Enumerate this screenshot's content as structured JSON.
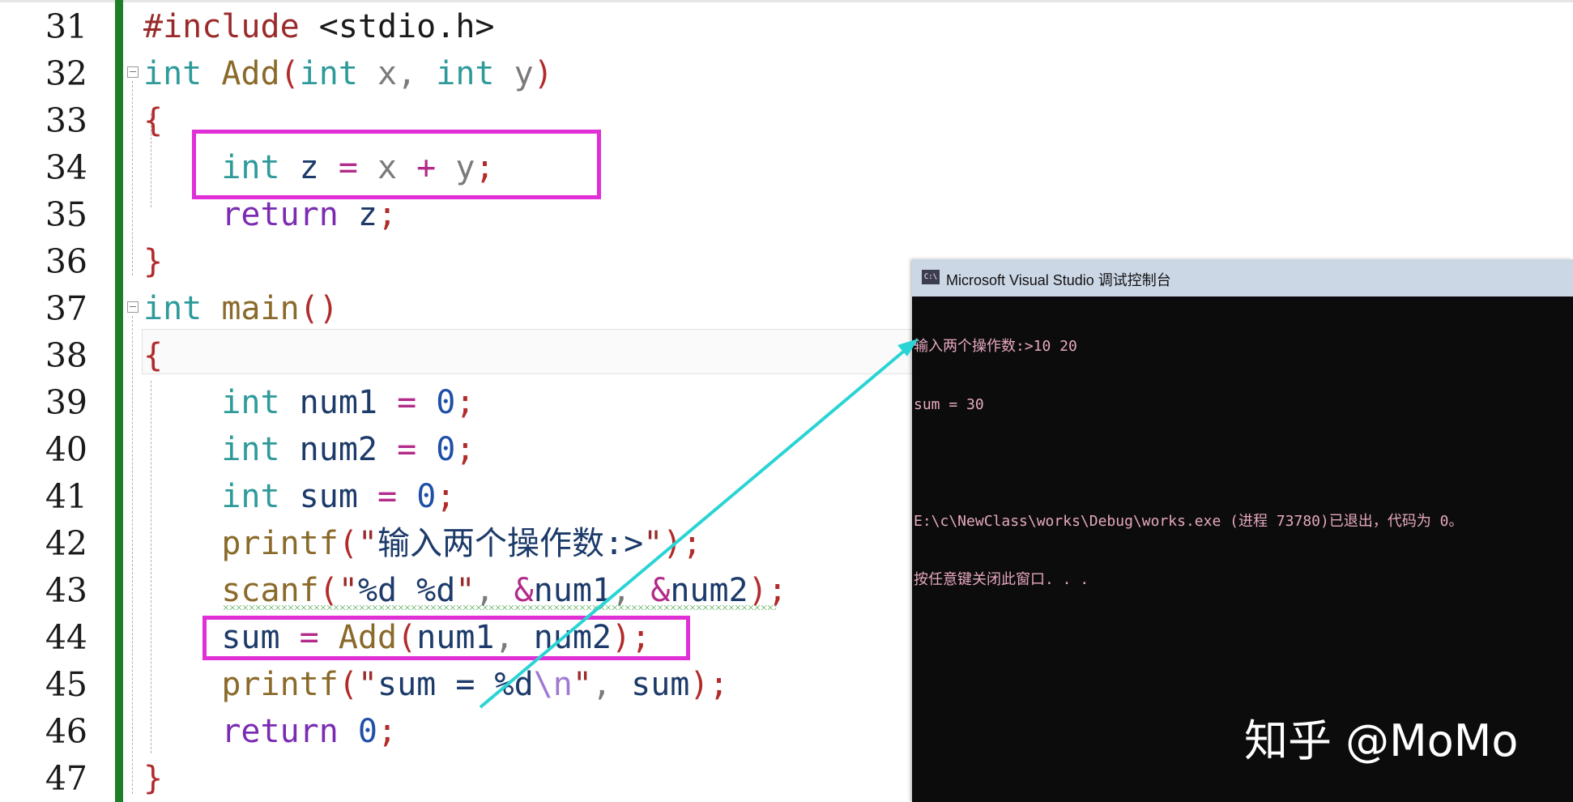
{
  "editor": {
    "lines": [
      {
        "num": "31",
        "tokens": [
          {
            "t": "#include ",
            "c": "pp"
          },
          {
            "t": "<stdio.h>",
            "c": "cn"
          }
        ]
      },
      {
        "num": "32",
        "tokens": [
          {
            "t": "int",
            "c": "kw"
          },
          {
            "t": " ",
            "c": "cn"
          },
          {
            "t": "Add",
            "c": "fn"
          },
          {
            "t": "(",
            "c": "br"
          },
          {
            "t": "int",
            "c": "kw"
          },
          {
            "t": " x, ",
            "c": "pr"
          },
          {
            "t": "int",
            "c": "kw"
          },
          {
            "t": " y",
            "c": "pr"
          },
          {
            "t": ")",
            "c": "br"
          }
        ]
      },
      {
        "num": "33",
        "tokens": [
          {
            "t": "{",
            "c": "br"
          }
        ]
      },
      {
        "num": "34",
        "tokens": [
          {
            "t": "    ",
            "c": "cn"
          },
          {
            "t": "int",
            "c": "kw"
          },
          {
            "t": " z ",
            "c": "var"
          },
          {
            "t": "=",
            "c": "op"
          },
          {
            "t": " x ",
            "c": "pr"
          },
          {
            "t": "+",
            "c": "op"
          },
          {
            "t": " y",
            "c": "pr"
          },
          {
            "t": ";",
            "c": "br"
          }
        ]
      },
      {
        "num": "35",
        "tokens": [
          {
            "t": "    ",
            "c": "cn"
          },
          {
            "t": "return",
            "c": "rt"
          },
          {
            "t": " z",
            "c": "var"
          },
          {
            "t": ";",
            "c": "br"
          }
        ]
      },
      {
        "num": "36",
        "tokens": [
          {
            "t": "}",
            "c": "br"
          }
        ]
      },
      {
        "num": "37",
        "tokens": [
          {
            "t": "int",
            "c": "kw"
          },
          {
            "t": " ",
            "c": "cn"
          },
          {
            "t": "main",
            "c": "fn"
          },
          {
            "t": "()",
            "c": "br"
          }
        ]
      },
      {
        "num": "38",
        "tokens": [
          {
            "t": "{",
            "c": "br"
          }
        ]
      },
      {
        "num": "39",
        "tokens": [
          {
            "t": "    ",
            "c": "cn"
          },
          {
            "t": "int",
            "c": "kw"
          },
          {
            "t": " num1 ",
            "c": "var"
          },
          {
            "t": "=",
            "c": "op"
          },
          {
            "t": " ",
            "c": "cn"
          },
          {
            "t": "0",
            "c": "num"
          },
          {
            "t": ";",
            "c": "br"
          }
        ]
      },
      {
        "num": "40",
        "tokens": [
          {
            "t": "    ",
            "c": "cn"
          },
          {
            "t": "int",
            "c": "kw"
          },
          {
            "t": " num2 ",
            "c": "var"
          },
          {
            "t": "=",
            "c": "op"
          },
          {
            "t": " ",
            "c": "cn"
          },
          {
            "t": "0",
            "c": "num"
          },
          {
            "t": ";",
            "c": "br"
          }
        ]
      },
      {
        "num": "41",
        "tokens": [
          {
            "t": "    ",
            "c": "cn"
          },
          {
            "t": "int",
            "c": "kw"
          },
          {
            "t": " sum ",
            "c": "var"
          },
          {
            "t": "=",
            "c": "op"
          },
          {
            "t": " ",
            "c": "cn"
          },
          {
            "t": "0",
            "c": "num"
          },
          {
            "t": ";",
            "c": "br"
          }
        ]
      },
      {
        "num": "42",
        "tokens": [
          {
            "t": "    ",
            "c": "cn"
          },
          {
            "t": "printf",
            "c": "fn"
          },
          {
            "t": "(",
            "c": "br"
          },
          {
            "t": "\"",
            "c": "str"
          },
          {
            "t": "输入两个操作数:>",
            "c": "var"
          },
          {
            "t": "\"",
            "c": "str"
          },
          {
            "t": ");",
            "c": "br"
          }
        ]
      },
      {
        "num": "43",
        "tokens": [
          {
            "t": "    ",
            "c": "cn"
          },
          {
            "t": "scanf",
            "c": "fn"
          },
          {
            "t": "(",
            "c": "br"
          },
          {
            "t": "\"",
            "c": "str"
          },
          {
            "t": "%d %d",
            "c": "var"
          },
          {
            "t": "\"",
            "c": "str"
          },
          {
            "t": ", ",
            "c": "pr"
          },
          {
            "t": "&",
            "c": "op"
          },
          {
            "t": "num1",
            "c": "var"
          },
          {
            "t": ", ",
            "c": "pr"
          },
          {
            "t": "&",
            "c": "op"
          },
          {
            "t": "num2",
            "c": "var"
          },
          {
            "t": ");",
            "c": "br"
          }
        ]
      },
      {
        "num": "44",
        "tokens": [
          {
            "t": "    ",
            "c": "cn"
          },
          {
            "t": "sum ",
            "c": "var"
          },
          {
            "t": "=",
            "c": "op"
          },
          {
            "t": " ",
            "c": "cn"
          },
          {
            "t": "Add",
            "c": "fn"
          },
          {
            "t": "(",
            "c": "br"
          },
          {
            "t": "num1",
            "c": "var"
          },
          {
            "t": ", ",
            "c": "pr"
          },
          {
            "t": "num2",
            "c": "var"
          },
          {
            "t": ");",
            "c": "br"
          }
        ]
      },
      {
        "num": "45",
        "tokens": [
          {
            "t": "    ",
            "c": "cn"
          },
          {
            "t": "printf",
            "c": "fn"
          },
          {
            "t": "(",
            "c": "br"
          },
          {
            "t": "\"",
            "c": "str"
          },
          {
            "t": "sum = %d",
            "c": "var"
          },
          {
            "t": "\\n",
            "c": "esc"
          },
          {
            "t": "\"",
            "c": "str"
          },
          {
            "t": ", ",
            "c": "pr"
          },
          {
            "t": "sum",
            "c": "var"
          },
          {
            "t": ");",
            "c": "br"
          }
        ]
      },
      {
        "num": "46",
        "tokens": [
          {
            "t": "    ",
            "c": "cn"
          },
          {
            "t": "return",
            "c": "rt"
          },
          {
            "t": " ",
            "c": "cn"
          },
          {
            "t": "0",
            "c": "num"
          },
          {
            "t": ";",
            "c": "br"
          }
        ]
      },
      {
        "num": "47",
        "tokens": [
          {
            "t": "}",
            "c": "br"
          }
        ]
      }
    ]
  },
  "console": {
    "title": "Microsoft Visual Studio 调试控制台",
    "icon_label": "C:\\",
    "output": [
      "输入两个操作数:>10 20",
      "sum = 30",
      "",
      "E:\\c\\NewClass\\works\\Debug\\works.exe (进程 73780)已退出，代码为 0。",
      "按任意键关闭此窗口. . ."
    ]
  },
  "watermark": "知乎 @MoMo",
  "colors": {
    "highlight_box": "#e02fd6",
    "arrow": "#2ad4d4",
    "gutter_bar": "#1e7d27",
    "console_bg": "#0c0c0c"
  }
}
